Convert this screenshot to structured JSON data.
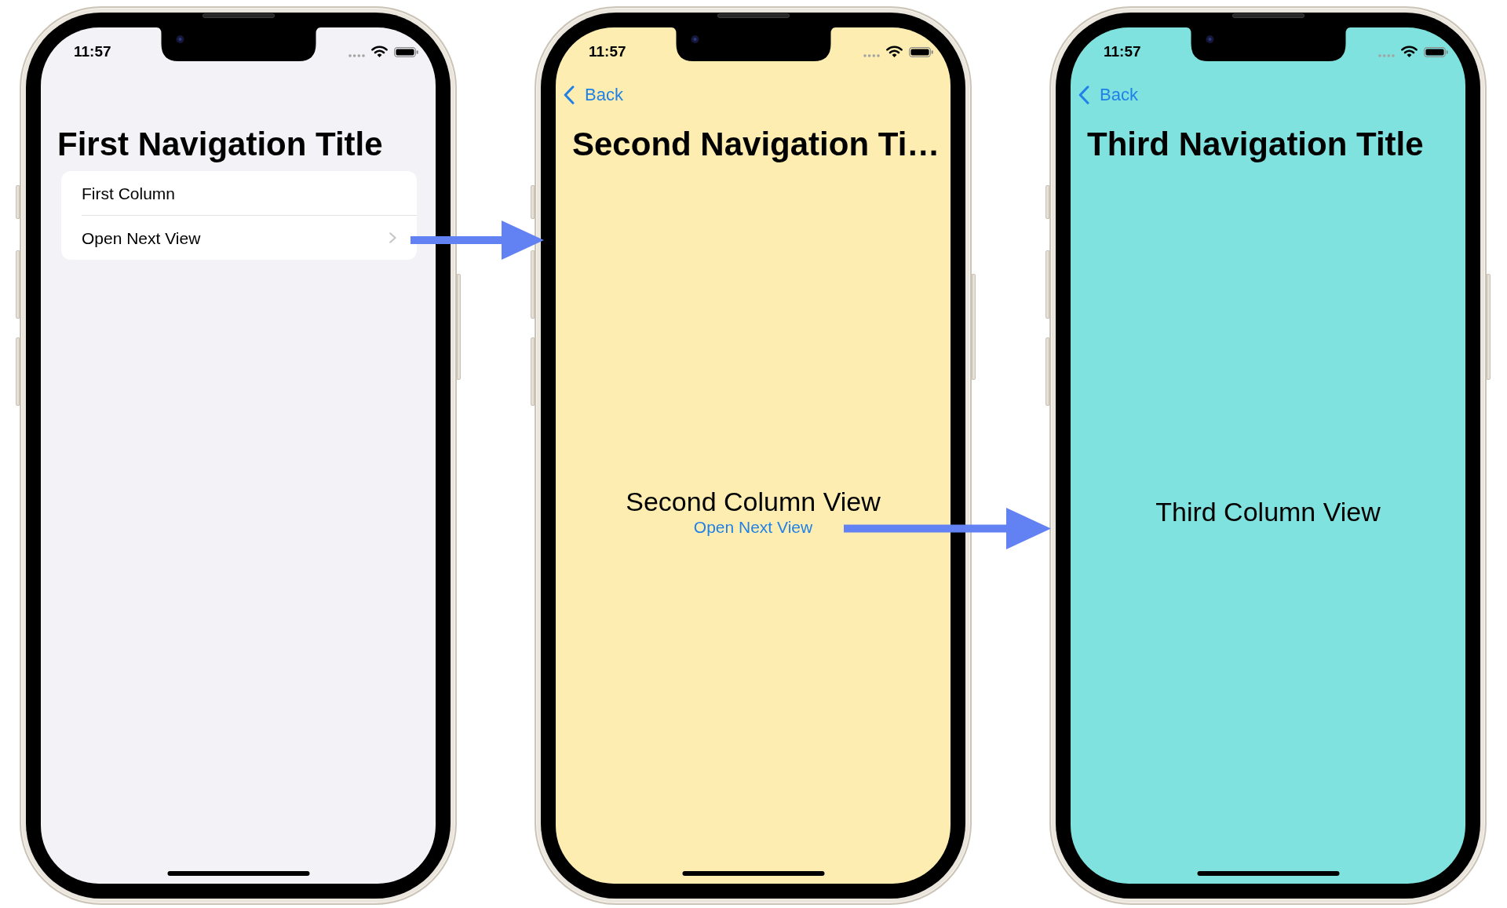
{
  "screens": [
    {
      "color": "#f2f2f7",
      "status_bar": {
        "time": "11:57"
      },
      "navigation_title": "First Navigation Title",
      "list": {
        "rows": [
          {
            "kind": "text",
            "label": "First Column"
          },
          {
            "kind": "navigation",
            "label": "Open Next View"
          }
        ]
      }
    },
    {
      "color": "#feedb0",
      "status_bar": {
        "time": "11:57"
      },
      "back_button": "Back",
      "navigation_title": "Second Navigation Ti…",
      "content": {
        "label": "Second Column View",
        "link": "Open Next View"
      }
    },
    {
      "color": "#80e2de",
      "status_bar": {
        "time": "11:57"
      },
      "back_button": "Back",
      "navigation_title": "Third Navigation Title",
      "content": {
        "label": "Third Column View"
      }
    }
  ]
}
